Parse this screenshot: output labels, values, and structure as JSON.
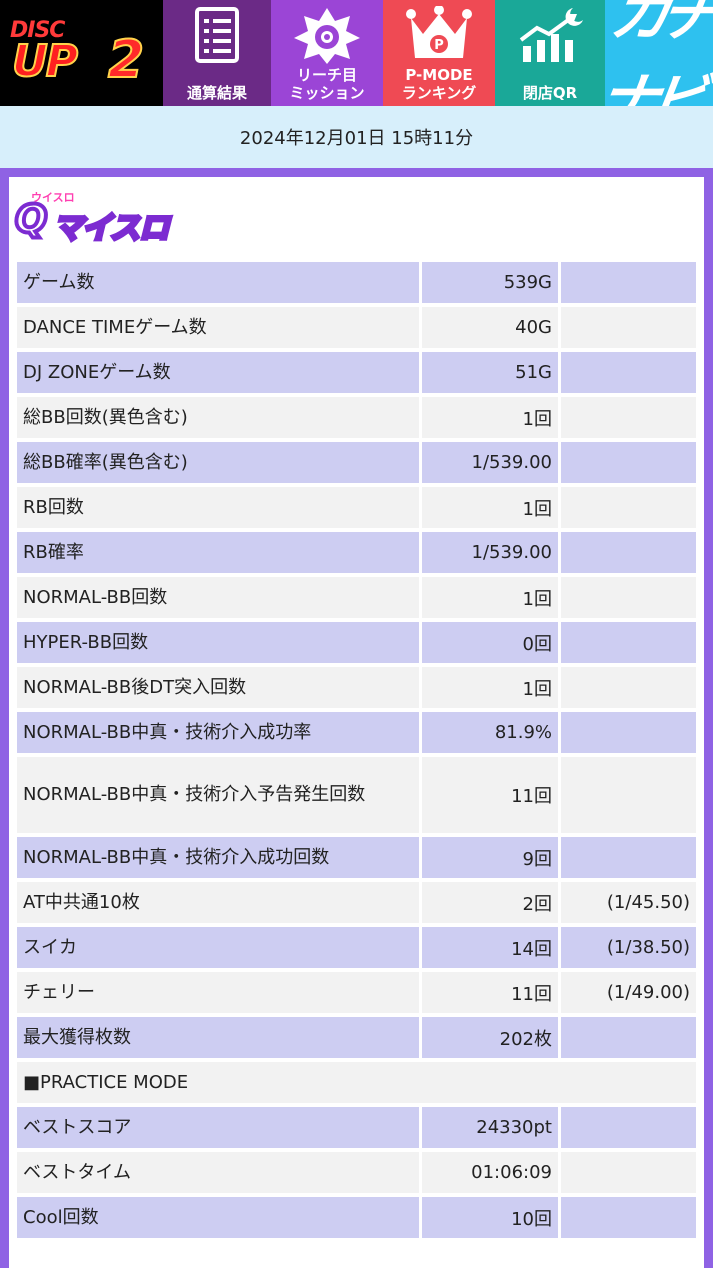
{
  "header": {
    "logo": {
      "disc": "DISC",
      "up": "UP",
      "num": "2"
    },
    "tiles": [
      {
        "label": "通算結果",
        "icon": "document-list-icon"
      },
      {
        "label": "リーチ目\nミッション",
        "icon": "star-eye-badge-icon"
      },
      {
        "label": "P-MODE\nランキング",
        "icon": "crown-p-icon"
      },
      {
        "label": "閉店QR",
        "icon": "chart-moon-icon"
      },
      {
        "label": "カチナビ",
        "icon": "kachinavi-logo"
      }
    ],
    "kachinavi_text": "カチナビ"
  },
  "date_text": "2024年12月01日 15時11分",
  "brand": {
    "small": "ウイスロ",
    "q": "Q",
    "main": "マイスロ"
  },
  "rows": [
    {
      "name": "ゲーム数",
      "value": "539G",
      "rate": ""
    },
    {
      "name": "DANCE TIMEゲーム数",
      "value": "40G",
      "rate": ""
    },
    {
      "name": "DJ ZONEゲーム数",
      "value": "51G",
      "rate": ""
    },
    {
      "name": "総BB回数(異色含む)",
      "value": "1回",
      "rate": ""
    },
    {
      "name": "総BB確率(異色含む)",
      "value": "1/539.00",
      "rate": ""
    },
    {
      "name": "RB回数",
      "value": "1回",
      "rate": ""
    },
    {
      "name": "RB確率",
      "value": "1/539.00",
      "rate": ""
    },
    {
      "name": "NORMAL-BB回数",
      "value": "1回",
      "rate": ""
    },
    {
      "name": "HYPER-BB回数",
      "value": "0回",
      "rate": ""
    },
    {
      "name": "NORMAL-BB後DT突入回数",
      "value": "1回",
      "rate": ""
    },
    {
      "name": "NORMAL-BB中真・技術介入成功率",
      "value": "81.9%",
      "rate": ""
    },
    {
      "name": "NORMAL-BB中真・技術介入予告発生回数",
      "value": "11回",
      "rate": "",
      "tall": true
    },
    {
      "name": "NORMAL-BB中真・技術介入成功回数",
      "value": "9回",
      "rate": ""
    },
    {
      "name": "AT中共通10枚",
      "value": "2回",
      "rate": "(1/45.50)"
    },
    {
      "name": "スイカ",
      "value": "14回",
      "rate": "(1/38.50)"
    },
    {
      "name": "チェリー",
      "value": "11回",
      "rate": "(1/49.00)"
    },
    {
      "name": "最大獲得枚数",
      "value": "202枚",
      "rate": ""
    },
    {
      "name": "■PRACTICE MODE",
      "section": true
    },
    {
      "name": "ベストスコア",
      "value": "24330pt",
      "rate": ""
    },
    {
      "name": "ベストタイム",
      "value": "01:06:09",
      "rate": ""
    },
    {
      "name": "Cool回数",
      "value": "10回",
      "rate": ""
    }
  ]
}
